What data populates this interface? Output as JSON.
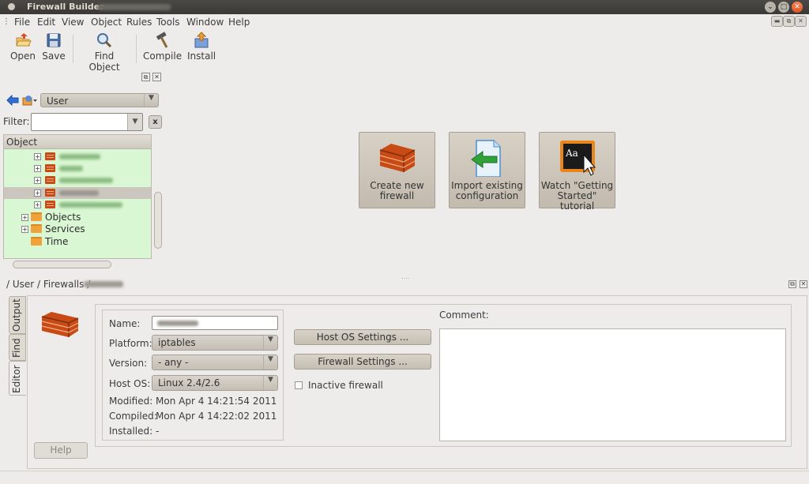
{
  "window": {
    "title": "Firewall Builder -",
    "controls": [
      "minimize",
      "maximize",
      "close"
    ]
  },
  "menubar": {
    "items": [
      {
        "label": "File"
      },
      {
        "label": "Edit"
      },
      {
        "label": "View"
      },
      {
        "label": "Object"
      },
      {
        "label": "Rules"
      },
      {
        "label": "Tools"
      },
      {
        "label": "Window"
      },
      {
        "label": "Help"
      }
    ]
  },
  "toolbar": {
    "open": "Open",
    "save": "Save",
    "find_object": "Find Object",
    "compile": "Compile",
    "install": "Install"
  },
  "library": {
    "selected": "User"
  },
  "filter": {
    "label": "Filter:",
    "value": "",
    "clear": "x"
  },
  "tree": {
    "header": "Object",
    "folders": [
      {
        "label": "Objects"
      },
      {
        "label": "Services"
      },
      {
        "label": "Time"
      }
    ]
  },
  "welcome": {
    "create": "Create new firewall",
    "import": "Import existing configuration",
    "watch": "Watch \"Getting Started\" tutorial"
  },
  "breadcrumb": "/ User / Firewalls /",
  "tabs": {
    "output": "Output",
    "find": "Find",
    "editor": "Editor"
  },
  "editor": {
    "name_label": "Name:",
    "platform_label": "Platform:",
    "platform_value": "iptables",
    "version_label": "Version:",
    "version_value": "- any -",
    "hostos_label": "Host OS:",
    "hostos_value": "Linux 2.4/2.6",
    "modified_label": "Modified:",
    "modified_value": "Mon Apr 4 14:21:54 2011",
    "compiled_label": "Compiled:",
    "compiled_value": "Mon Apr 4 14:22:02 2011",
    "installed_label": "Installed:",
    "installed_value": "-",
    "host_os_settings": "Host OS Settings ...",
    "firewall_settings": "Firewall Settings ...",
    "inactive_label": "Inactive firewall",
    "comment_label": "Comment:",
    "help": "Help"
  }
}
